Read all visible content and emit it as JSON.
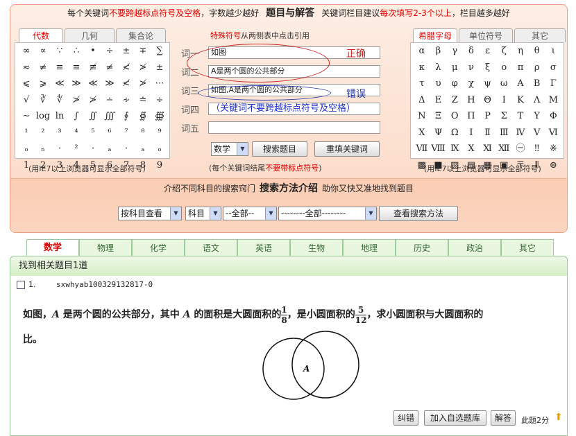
{
  "header": {
    "p1": "每个关键词",
    "p2": "不要跨越标点符号及空格",
    "p3": "，字数越少越好",
    "title": "题目与解答",
    "p4": "关键词栏目建议",
    "p5": "每次填写2-3个以上",
    "p6": "，栏目越多越好"
  },
  "left_panel": {
    "tabs": [
      "代数",
      "几何",
      "集合论"
    ],
    "symbols": [
      "∞",
      "∝",
      "∵",
      "∴",
      "•",
      "÷",
      "±",
      "∓",
      "∑",
      "≈",
      "≠",
      "≡",
      "≡",
      "≢",
      "≠",
      "≮",
      "≯",
      "±",
      "⩽",
      "⩾",
      "≪",
      "≫",
      "≪",
      "≫",
      "≮",
      "≯",
      "⋯",
      "√",
      "∛",
      "∜",
      "≯",
      "≯",
      "∸",
      "∻",
      "≐",
      "÷",
      "∼",
      "log",
      "ln",
      "∫",
      "∬",
      "∭",
      "∮",
      "∯",
      "∰",
      "¹",
      "²",
      "³",
      "⁴",
      "⁵",
      "⁶",
      "⁷",
      "⁸",
      "⁹",
      "ₒ",
      "ₙ",
      "·",
      "²",
      "·",
      "ₐ",
      "·",
      "ₐ",
      "ₒ",
      "1",
      "2",
      "3",
      "4",
      "5",
      "6",
      "7",
      "8",
      "9"
    ],
    "note": "(用IE7以上浏览器可显示全部符号)"
  },
  "center": {
    "special_hint_red": "特殊符号",
    "special_hint": "从两侧表中点击引用",
    "labels": [
      "词一",
      "词二",
      "词三",
      "词四",
      "词五"
    ],
    "values": [
      "如图",
      "A是两个圆的公共部分",
      "如图,A是两个圆的公共部分",
      "（关键词不要跨越标点符号及空格）",
      ""
    ],
    "annot_correct": "正确",
    "annot_wrong": "错误",
    "subject": "数学",
    "search_btn": "搜索题目",
    "reset_btn": "重填关键词",
    "note1": "(每个关键词结尾",
    "note_red": "不要带标点符号",
    "note2": ")"
  },
  "right_panel": {
    "tabs": [
      "希腊字母",
      "单位符号",
      "其它"
    ],
    "symbols": [
      "α",
      "β",
      "γ",
      "δ",
      "ε",
      "ζ",
      "η",
      "θ",
      "ι",
      "κ",
      "λ",
      "μ",
      "ν",
      "ξ",
      "ο",
      "π",
      "ρ",
      "σ",
      "τ",
      "υ",
      "φ",
      "χ",
      "ψ",
      "ω",
      "Α",
      "Β",
      "Γ",
      "Δ",
      "Ε",
      "Ζ",
      "Η",
      "Θ",
      "Ι",
      "Κ",
      "Λ",
      "Μ",
      "Ν",
      "Ξ",
      "Ο",
      "Π",
      "Ρ",
      "Σ",
      "Τ",
      "Υ",
      "Φ",
      "Χ",
      "Ψ",
      "Ω",
      "Ⅰ",
      "Ⅱ",
      "Ⅲ",
      "Ⅳ",
      "Ⅴ",
      "Ⅵ",
      "Ⅶ",
      "Ⅷ",
      "Ⅸ",
      "Ⅹ",
      "Ⅺ",
      "Ⅻ",
      "㊀",
      "‼",
      "※",
      "▩",
      "■",
      "▨",
      "▤",
      "▦",
      "▣",
      "〒",
      "⫴",
      "⊜"
    ],
    "note": "(用IE7以上浏览器可显示全部符号)"
  },
  "method": {
    "p1": "介绍不同科目的搜索窍门",
    "title": "搜索方法介绍",
    "p2": "助你又快又准地找到题目"
  },
  "filters": {
    "by_subject": "按科目查看",
    "subject": "科目",
    "all1": "--全部--",
    "all2": "--------全部--------",
    "view_btn": "查看搜索方法"
  },
  "subject_tabs": [
    "数学",
    "物理",
    "化学",
    "语文",
    "英语",
    "生物",
    "地理",
    "历史",
    "政治",
    "其它"
  ],
  "results": {
    "count": "找到相关题目1道",
    "index": "1.",
    "id": "sxwhyab100329132817-0",
    "q1": "如图，",
    "qA": "A",
    "q2": " 是两个圆的公共部分，其中 ",
    "q3": " 的面积是大圆面积的",
    "f1n": "1",
    "f1d": "8",
    "q4": "，是小圆面积的",
    "f2n": "5",
    "f2d": "12",
    "q5": "，求小圆面积与大圆面积的",
    "q6": "比。",
    "figlabel": "A",
    "btn_error": "纠错",
    "btn_add": "加入自选题库",
    "btn_answer": "解答",
    "score": "此题2分"
  },
  "colors": {
    "accent_red": "#d00000",
    "green": "#9c9",
    "annot_red": "#cc2222",
    "annot_blue": "#2233aa"
  }
}
